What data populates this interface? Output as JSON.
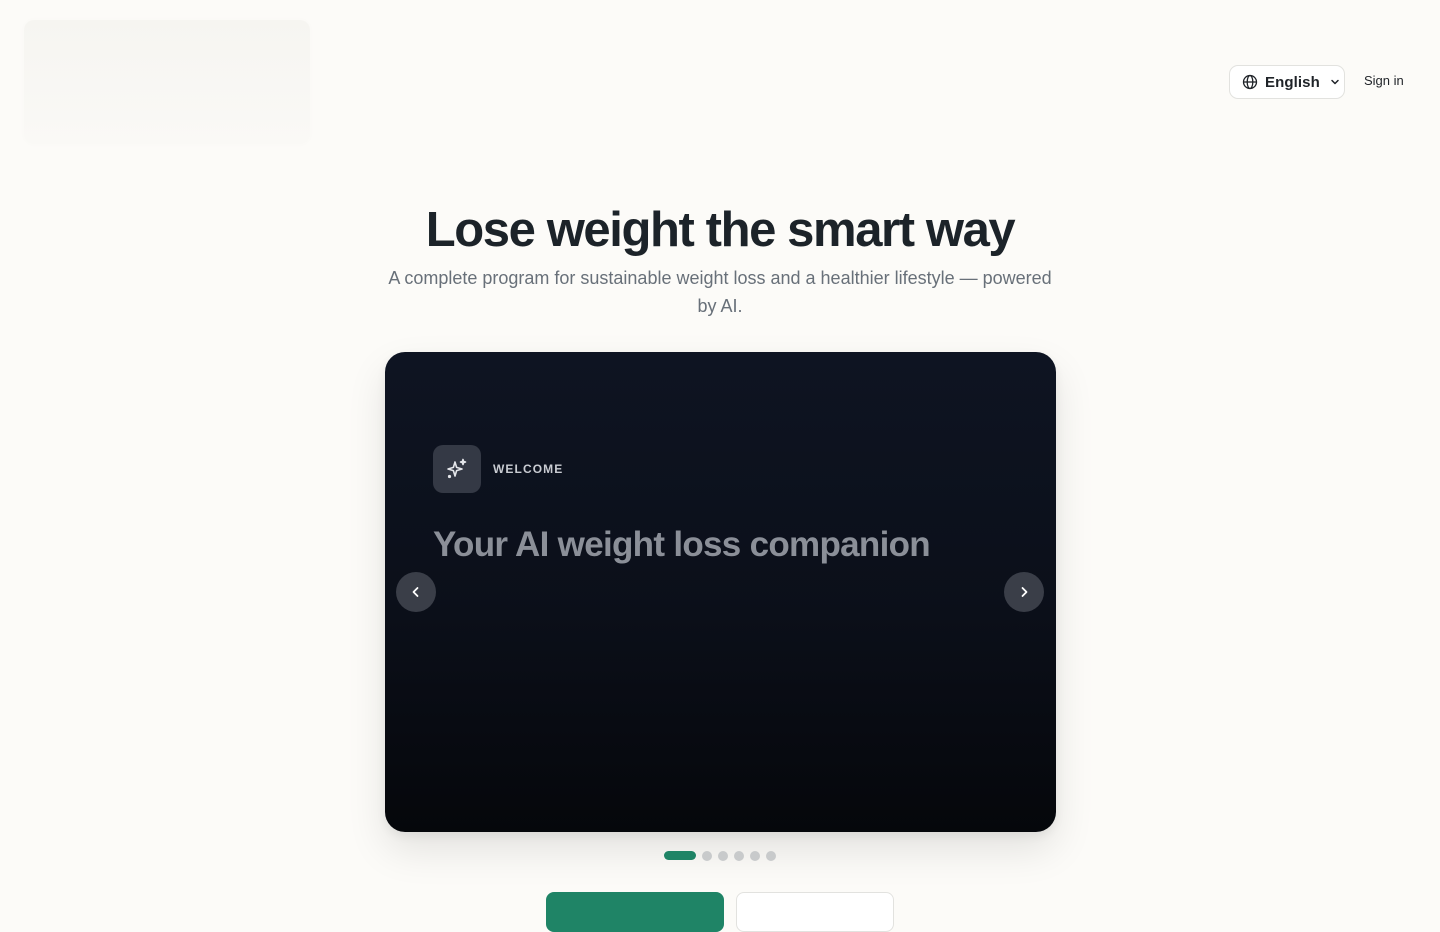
{
  "header": {
    "language_label": "English",
    "signin_label": "Sign in"
  },
  "hero": {
    "title": "Lose weight the smart way",
    "subtitle": "A complete program for sustainable weight loss and a healthier lifestyle — powered by AI."
  },
  "carousel": {
    "current_slide": 1,
    "total_slides": 6,
    "slide": {
      "eyebrow": "WELCOME",
      "heading": "Your AI weight loss companion",
      "icon": "sparkles-icon"
    }
  },
  "colors": {
    "accent": "#1f8466",
    "background": "#fcfbf8",
    "card": "#0b0f19",
    "text_primary": "#1c2329",
    "text_muted": "#687079"
  },
  "icons": {
    "language": "globe-icon",
    "dropdown": "chevron-down-icon",
    "prev": "chevron-left-icon",
    "next": "chevron-right-icon"
  }
}
